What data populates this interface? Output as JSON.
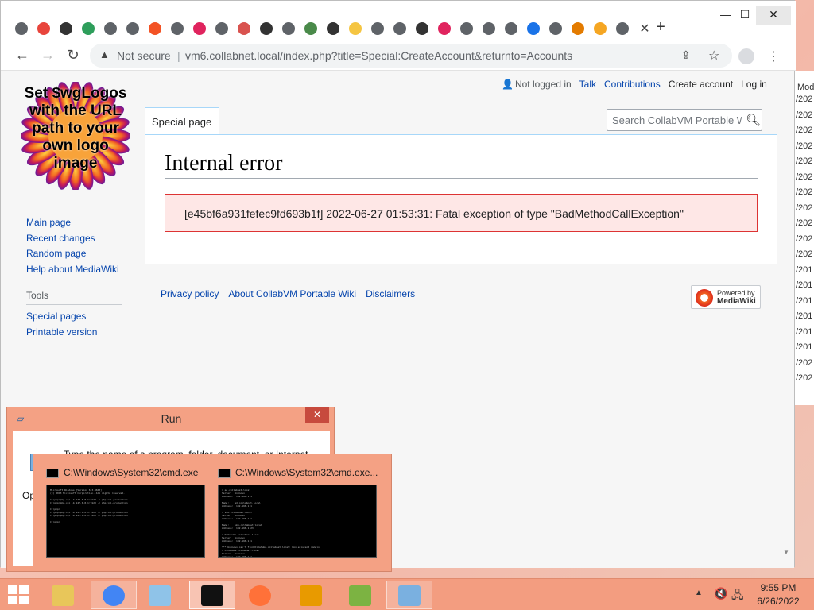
{
  "browser": {
    "window_controls": {
      "minimize": "—",
      "maximize": "☐",
      "close": "✕"
    },
    "active_tab_close": "✕",
    "new_tab": "+",
    "favicon_colors": [
      "#5f6368",
      "#e8453c",
      "#333333",
      "#2e9e5b",
      "#5f6368",
      "#5f6368",
      "#f35325",
      "#5f6368",
      "#e0245e",
      "#5f6368",
      "#d9534f",
      "#333333",
      "#5f6368",
      "#4a8a4a",
      "#333333",
      "#f5c542",
      "#5f6368",
      "#5f6368",
      "#333333",
      "#e0245e",
      "#5f6368",
      "#5f6368",
      "#5f6368",
      "#1a73e8",
      "#5f6368",
      "#e37b00",
      "#f5a623",
      "#5f6368"
    ],
    "omnibox": {
      "security_label": "Not secure",
      "separator": "|",
      "url": "vm6.collabnet.local/index.php?title=Special:CreateAccount&returnto=Accounts"
    }
  },
  "wiki": {
    "logo_text": "Set $wgLogos with the URL path to your own logo image",
    "personal": {
      "user_status": "Not logged in",
      "links": [
        "Talk",
        "Contributions",
        "Create account",
        "Log in"
      ]
    },
    "tab_label": "Special page",
    "search_placeholder": "Search CollabVM Portable W",
    "sidebar": {
      "nav": [
        "Main page",
        "Recent changes",
        "Random page",
        "Help about MediaWiki"
      ],
      "tools_heading": "Tools",
      "tools": [
        "Special pages",
        "Printable version"
      ]
    },
    "title": "Internal error",
    "error_message": "[e45bf6a931fefec9fd693b1f] 2022-06-27 01:53:31: Fatal exception of type \"BadMethodCallException\"",
    "footer": [
      "Privacy policy",
      "About CollabVM Portable Wiki",
      "Disclaimers"
    ],
    "powered_by": {
      "line1": "Powered by",
      "line2": "MediaWiki"
    }
  },
  "background_window": {
    "header": "Mod",
    "rows": [
      "/202",
      "/202",
      "/202",
      "/202",
      "/202",
      "/202",
      "/202",
      "/202",
      "/202",
      "/202",
      "/202",
      "/201",
      "/201",
      "/201",
      "/201",
      "/201",
      "/201",
      "/202",
      "/202"
    ]
  },
  "run_dialog": {
    "title": "Run",
    "close": "✕",
    "prompt": "Type the name of a program, folder, document, or Internet",
    "open_label": "Op"
  },
  "thumbnails": [
    {
      "title": "C:\\Windows\\System32\\cmd.exe",
      "lines": [
        "Microsoft Windows [Version 6.3.9600]",
        "(c) 2013 Microsoft Corporation. All rights reserved.",
        "",
        "C:\\php>php-cgi -b 127.0.0.1:9123 -c php.ini-production",
        "C:\\php>php-cgi -b 127.0.0.1:9123 -c php.ini-production",
        "",
        "C:\\php>",
        "C:\\php>php-cgi -b 127.0.0.1:9123 -c php.ini-production",
        "C:\\php>php-cgi -b 127.0.0.1:9123 -c php.ini-production",
        "",
        "C:\\php>"
      ]
    },
    {
      "title": "C:\\Windows\\System32\\cmd.exe...",
      "lines": [
        "> ad.collabnet.local",
        "Server:  UnKnown",
        "Address:  192.168.1.1",
        "",
        "Name:    ad.collabnet.local",
        "Address:  192.168.1.1",
        "",
        "> vm6.collabnet.local",
        "Server:  UnKnown",
        "Address:  192.168.1.1",
        "",
        "Name:    vm6.collabnet.local",
        "Address:  192.168.1.23",
        "",
        "> DiOahuba.collabnet.local",
        "Server:  UnKnown",
        "Address:  192.168.1.1",
        "",
        "*** UnKnown can't find DiOahuba.collabnet.local: Non-existent domain",
        "> dihahuba.collabnet.local",
        "Server:  UnKnown",
        "Address:  192.168.1.1",
        "*** UnKnown can't find dihahuba.collabnet.local: Non-existent domain"
      ]
    }
  ],
  "taskbar": {
    "apps": [
      {
        "name": "file-explorer",
        "color": "#e8c65a",
        "state": "normal"
      },
      {
        "name": "chrome",
        "color": "#4285f4",
        "state": "open"
      },
      {
        "name": "notepad-app",
        "color": "#8fc3e8",
        "state": "normal"
      },
      {
        "name": "cmd",
        "color": "#111111",
        "state": "active"
      },
      {
        "name": "firefox",
        "color": "#ff7139",
        "state": "normal"
      },
      {
        "name": "search-magnifier",
        "color": "#e89a00",
        "state": "normal"
      },
      {
        "name": "notepad-plus-plus",
        "color": "#7cb342",
        "state": "normal"
      },
      {
        "name": "run",
        "color": "#7ab0e0",
        "state": "open"
      }
    ],
    "tray": {
      "up_arrow": "▲",
      "sound": "🔇",
      "network": "🖧"
    },
    "time": "9:55 PM",
    "date": "6/26/2022"
  }
}
